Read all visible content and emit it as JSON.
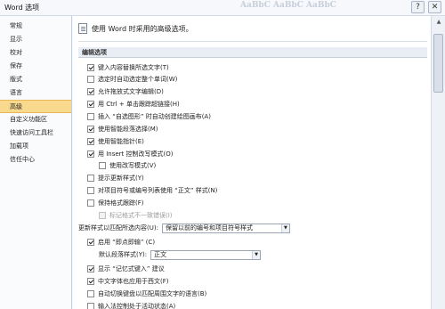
{
  "window": {
    "title": "Word 选项",
    "ribbon_ghost": "AaBbC AaBbC AaBbC",
    "help_glyph": "?",
    "close_glyph": "✕"
  },
  "sidebar": {
    "items": [
      {
        "label": "常规"
      },
      {
        "label": "显示"
      },
      {
        "label": "校对"
      },
      {
        "label": "保存"
      },
      {
        "label": "版式"
      },
      {
        "label": "语言"
      },
      {
        "label": "高级",
        "active": true
      },
      {
        "label": "自定义功能区"
      },
      {
        "label": "快速访问工具栏"
      },
      {
        "label": "加载项"
      },
      {
        "label": "信任中心"
      }
    ]
  },
  "content": {
    "header": "使用 Word 时采用的高级选项。",
    "section_title": "编辑选项",
    "options": [
      {
        "label": "键入内容替换所选文字(T)",
        "checked": true
      },
      {
        "label": "选定时自动选定整个单词(W)",
        "checked": false
      },
      {
        "label": "允许拖放式文字编辑(D)",
        "checked": true
      },
      {
        "label": "用 Ctrl + 单击跟踪超链接(H)",
        "checked": true
      },
      {
        "label": "插入 “自选图形” 时自动创建绘图画布(A)",
        "checked": false
      },
      {
        "label": "使用智能段落选择(M)",
        "checked": true
      },
      {
        "label": "使用智能指针(E)",
        "checked": true
      },
      {
        "label": "用 Insert 控制改写模式(O)",
        "checked": true
      },
      {
        "label": "使用改写模式(V)",
        "checked": false,
        "indent": true
      },
      {
        "label": "提示更新样式(Y)",
        "checked": false
      },
      {
        "label": "对项目符号或编号列表使用 “正文” 样式(N)",
        "checked": false
      },
      {
        "label": "保持格式跟踪(F)",
        "checked": false
      },
      {
        "label": "标记格式不一致错误(I)",
        "checked": false,
        "indent": true,
        "disabled": true
      }
    ],
    "paste_combo": {
      "label": "更新样式以匹配所选内容(U):",
      "value": "保留以前的编号和项目符号样式"
    },
    "options2": [
      {
        "label": "启用 “即点即输” (C)",
        "checked": true
      }
    ],
    "default_style": {
      "label": "默认段落样式(Y):",
      "value": "正文"
    },
    "options3": [
      {
        "label": "显示 “记忆式键入” 建议",
        "checked": true
      },
      {
        "label": "中文字体也应用于西文(F)",
        "checked": true
      },
      {
        "label": "自动切换键盘以匹配周围文字的语言(B)",
        "checked": false
      },
      {
        "label": "输入法控制处于活动状态(A)",
        "checked": false
      }
    ]
  },
  "scrollbar": {
    "up_glyph": "▲"
  }
}
